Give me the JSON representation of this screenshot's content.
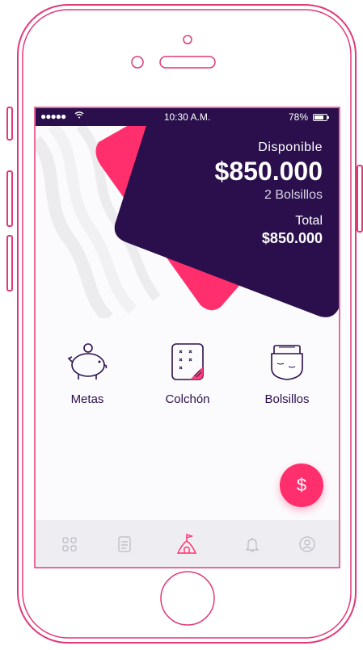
{
  "status_bar": {
    "signal": "●●●●●",
    "time": "10:30 A.M.",
    "battery": "78%"
  },
  "balance": {
    "available_label": "Disponible",
    "available_amount": "$850.000",
    "pockets_count": "2 Bolsillos",
    "total_label": "Total",
    "total_amount": "$850.000"
  },
  "shortcuts": [
    {
      "label": "Metas",
      "icon": "piggy-bank-icon"
    },
    {
      "label": "Colchón",
      "icon": "mattress-icon"
    },
    {
      "label": "Bolsillos",
      "icon": "pocket-icon"
    }
  ],
  "fab": {
    "label": "$"
  },
  "tabbar": {
    "items": [
      "grid-icon",
      "document-icon",
      "home-icon",
      "bell-icon",
      "profile-icon"
    ],
    "active": "home-icon"
  },
  "colors": {
    "primary": "#2a0f4c",
    "accent": "#ff2f6d",
    "frame": "#e0397a"
  }
}
